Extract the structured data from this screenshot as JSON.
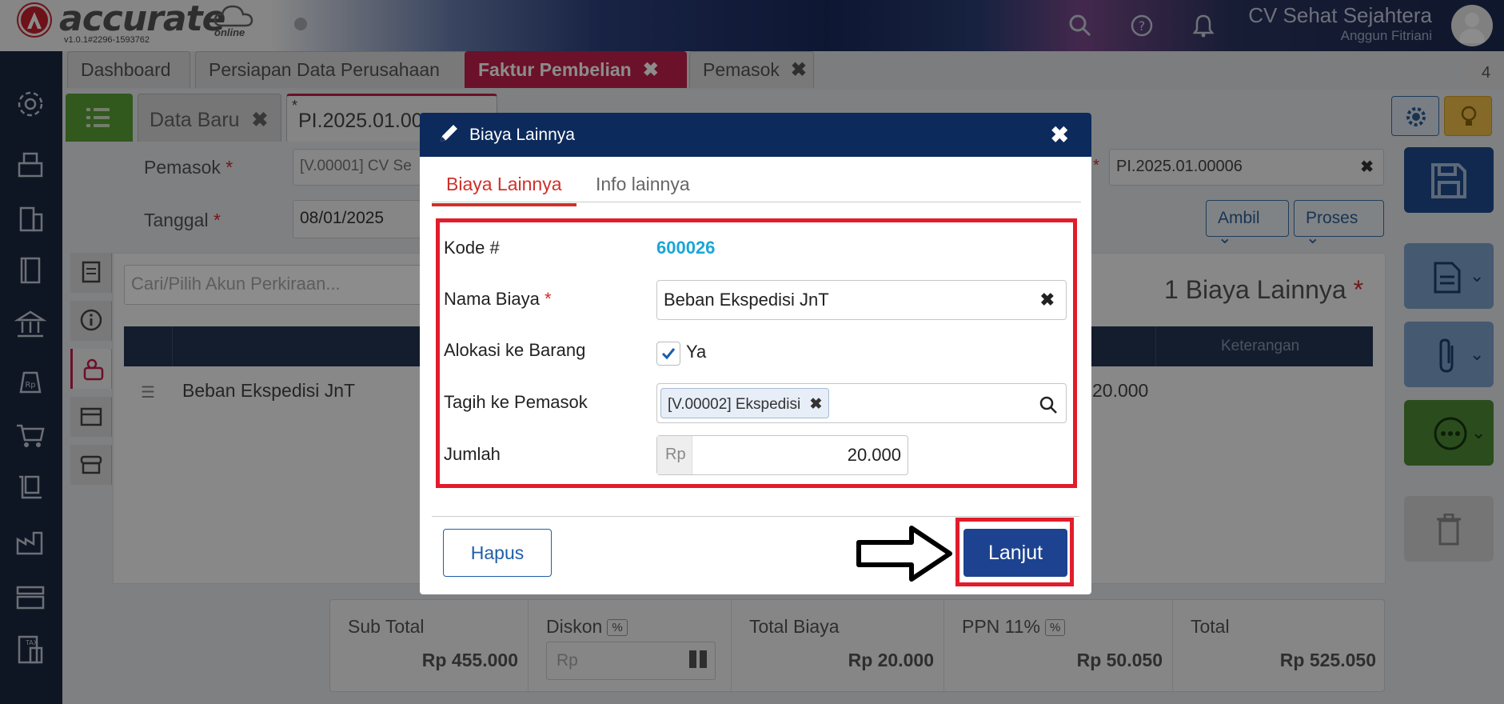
{
  "app": {
    "logo_text": "accurate",
    "logo_sub": "online",
    "version": "v1.0.1#2296-1593762",
    "company_name": "CV Sehat Sejahtera",
    "user_name": "Anggun Fitriani"
  },
  "main_tabs": [
    {
      "label": "Dashboard"
    },
    {
      "label": "Persiapan Data Perusahaan"
    },
    {
      "label": "Faktur Pembelian",
      "close": "✖"
    },
    {
      "label": "Pemasok",
      "close": "✖"
    }
  ],
  "tab_count": "4",
  "sub_tabs": {
    "data_baru": "Data Baru",
    "data_baru_close": "✖",
    "current": "PI.2025.01.00006",
    "modified_mark": "*"
  },
  "form": {
    "pemasok_label": "Pemasok",
    "pemasok_value": "[V.00001] CV Se",
    "tanggal_label": "Tanggal",
    "tanggal_value": "08/01/2025",
    "nomor_value": "PI.2025.01.00006",
    "clear": "✖",
    "required": "*",
    "ambil_button": "Ambil",
    "proses_button": "Proses"
  },
  "biaya_panel": {
    "search_placeholder": "Cari/Pilih Akun Perkiraan...",
    "title": "1 Biaya Lainnya",
    "col_keterangan": "Keterangan",
    "row_name": "Beban Ekspedisi JnT",
    "row_amount": "20.000"
  },
  "totals": {
    "sub_total_label": "Sub Total",
    "sub_total_value": "Rp 455.000",
    "diskon_label": "Diskon",
    "diskon_pct": "%",
    "diskon_placeholder": "Rp",
    "total_biaya_label": "Total Biaya",
    "total_biaya_value": "Rp 20.000",
    "ppn_label": "PPN 11%",
    "ppn_pct": "%",
    "ppn_value": "Rp 50.050",
    "total_label": "Total",
    "total_value": "Rp 525.050"
  },
  "modal": {
    "title": "Biaya Lainnya",
    "close": "✖",
    "tabs": [
      "Biaya Lainnya",
      "Info lainnya"
    ],
    "kode_label": "Kode #",
    "kode_value": "600026",
    "nama_label": "Nama Biaya",
    "nama_required": "*",
    "nama_value": "Beban Ekspedisi JnT",
    "nama_clear": "✖",
    "alokasi_label": "Alokasi ke Barang",
    "alokasi_check": "Ya",
    "tagih_label": "Tagih ke Pemasok",
    "tagih_tag": "[V.00002] Ekspedisi",
    "tagih_tag_remove": "✖",
    "jumlah_label": "Jumlah",
    "jumlah_prefix": "Rp",
    "jumlah_value": "20.000",
    "hapus_button": "Hapus",
    "lanjut_button": "Lanjut"
  },
  "colors": {
    "sidebar": "#1c2941",
    "active_tab": "#c4204c",
    "modal_header": "#0c2a5b",
    "primary_button": "#1d4390",
    "highlight_red": "#e21c2a",
    "kode_link": "#1aa6d6"
  },
  "icons": [
    "search-icon",
    "help-icon",
    "bell-icon",
    "gear-icon",
    "lightbulb-icon",
    "save-icon",
    "document-icon",
    "paperclip-icon",
    "more-icon",
    "trash-icon",
    "pencil-icon",
    "close-icon",
    "checkbox-icon",
    "arrow-right-icon"
  ]
}
